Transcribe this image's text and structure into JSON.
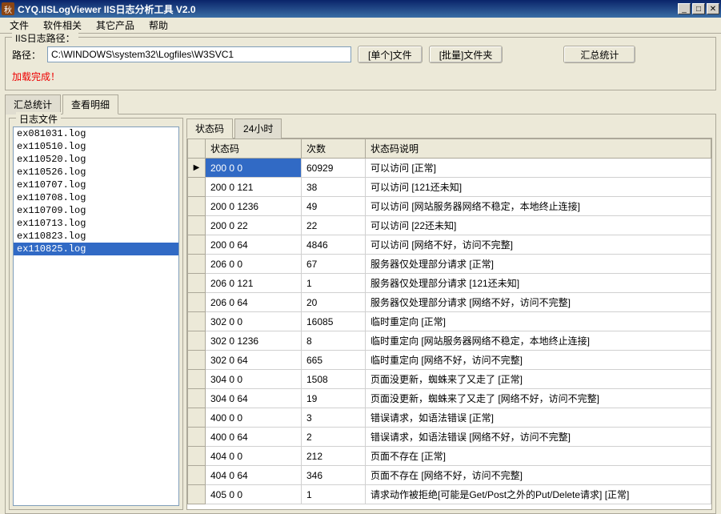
{
  "window": {
    "icon_glyph": "秋",
    "title": "CYQ.IISLogViewer IIS日志分析工具 V2.0"
  },
  "menu": [
    "文件",
    "软件相关",
    "其它产品",
    "帮助"
  ],
  "pathbox": {
    "legend": "IIS日志路径：",
    "label": "路径：",
    "value": "C:\\WINDOWS\\system32\\Logfiles\\W3SVC1",
    "btn_single": "[单个]文件",
    "btn_batch": "[批量]文件夹",
    "btn_summary": "汇总统计",
    "status": "加载完成！"
  },
  "main_tabs": {
    "summary": "汇总统计",
    "detail": "查看明细",
    "active": "detail"
  },
  "files": {
    "legend": "日志文件",
    "items": [
      "ex081031.log",
      "ex110510.log",
      "ex110520.log",
      "ex110526.log",
      "ex110707.log",
      "ex110708.log",
      "ex110709.log",
      "ex110713.log",
      "ex110823.log",
      "ex110825.log"
    ],
    "selected": "ex110825.log"
  },
  "detail_tabs": {
    "status": "状态码",
    "hour": "24小时",
    "active": "status"
  },
  "grid": {
    "headers": {
      "code": "状态码",
      "count": "次数",
      "desc": "状态码说明"
    },
    "rows": [
      {
        "code": "200 0 0",
        "count": "60929",
        "desc": "可以访问 [正常]",
        "sel": true
      },
      {
        "code": "200 0 121",
        "count": "38",
        "desc": "可以访问 [121还未知]"
      },
      {
        "code": "200 0 1236",
        "count": "49",
        "desc": "可以访问 [网站服务器网络不稳定，本地终止连接]"
      },
      {
        "code": "200 0 22",
        "count": "22",
        "desc": "可以访问 [22还未知]"
      },
      {
        "code": "200 0 64",
        "count": "4846",
        "desc": "可以访问 [网络不好，访问不完整]"
      },
      {
        "code": "206 0 0",
        "count": "67",
        "desc": "服务器仅处理部分请求 [正常]"
      },
      {
        "code": "206 0 121",
        "count": "1",
        "desc": "服务器仅处理部分请求 [121还未知]"
      },
      {
        "code": "206 0 64",
        "count": "20",
        "desc": "服务器仅处理部分请求 [网络不好，访问不完整]"
      },
      {
        "code": "302 0 0",
        "count": "16085",
        "desc": "临时重定向 [正常]"
      },
      {
        "code": "302 0 1236",
        "count": "8",
        "desc": "临时重定向 [网站服务器网络不稳定，本地终止连接]"
      },
      {
        "code": "302 0 64",
        "count": "665",
        "desc": "临时重定向 [网络不好，访问不完整]"
      },
      {
        "code": "304 0 0",
        "count": "1508",
        "desc": "页面没更新，蜘蛛来了又走了 [正常]"
      },
      {
        "code": "304 0 64",
        "count": "19",
        "desc": "页面没更新，蜘蛛来了又走了 [网络不好，访问不完整]"
      },
      {
        "code": "400 0 0",
        "count": "3",
        "desc": "错误请求，如语法错误 [正常]"
      },
      {
        "code": "400 0 64",
        "count": "2",
        "desc": "错误请求，如语法错误 [网络不好，访问不完整]"
      },
      {
        "code": "404 0 0",
        "count": "212",
        "desc": "页面不存在 [正常]"
      },
      {
        "code": "404 0 64",
        "count": "346",
        "desc": "页面不存在 [网络不好，访问不完整]"
      },
      {
        "code": "405 0 0",
        "count": "1",
        "desc": "请求动作被拒绝[可能是Get/Post之外的Put/Delete请求] [正常]"
      }
    ]
  }
}
